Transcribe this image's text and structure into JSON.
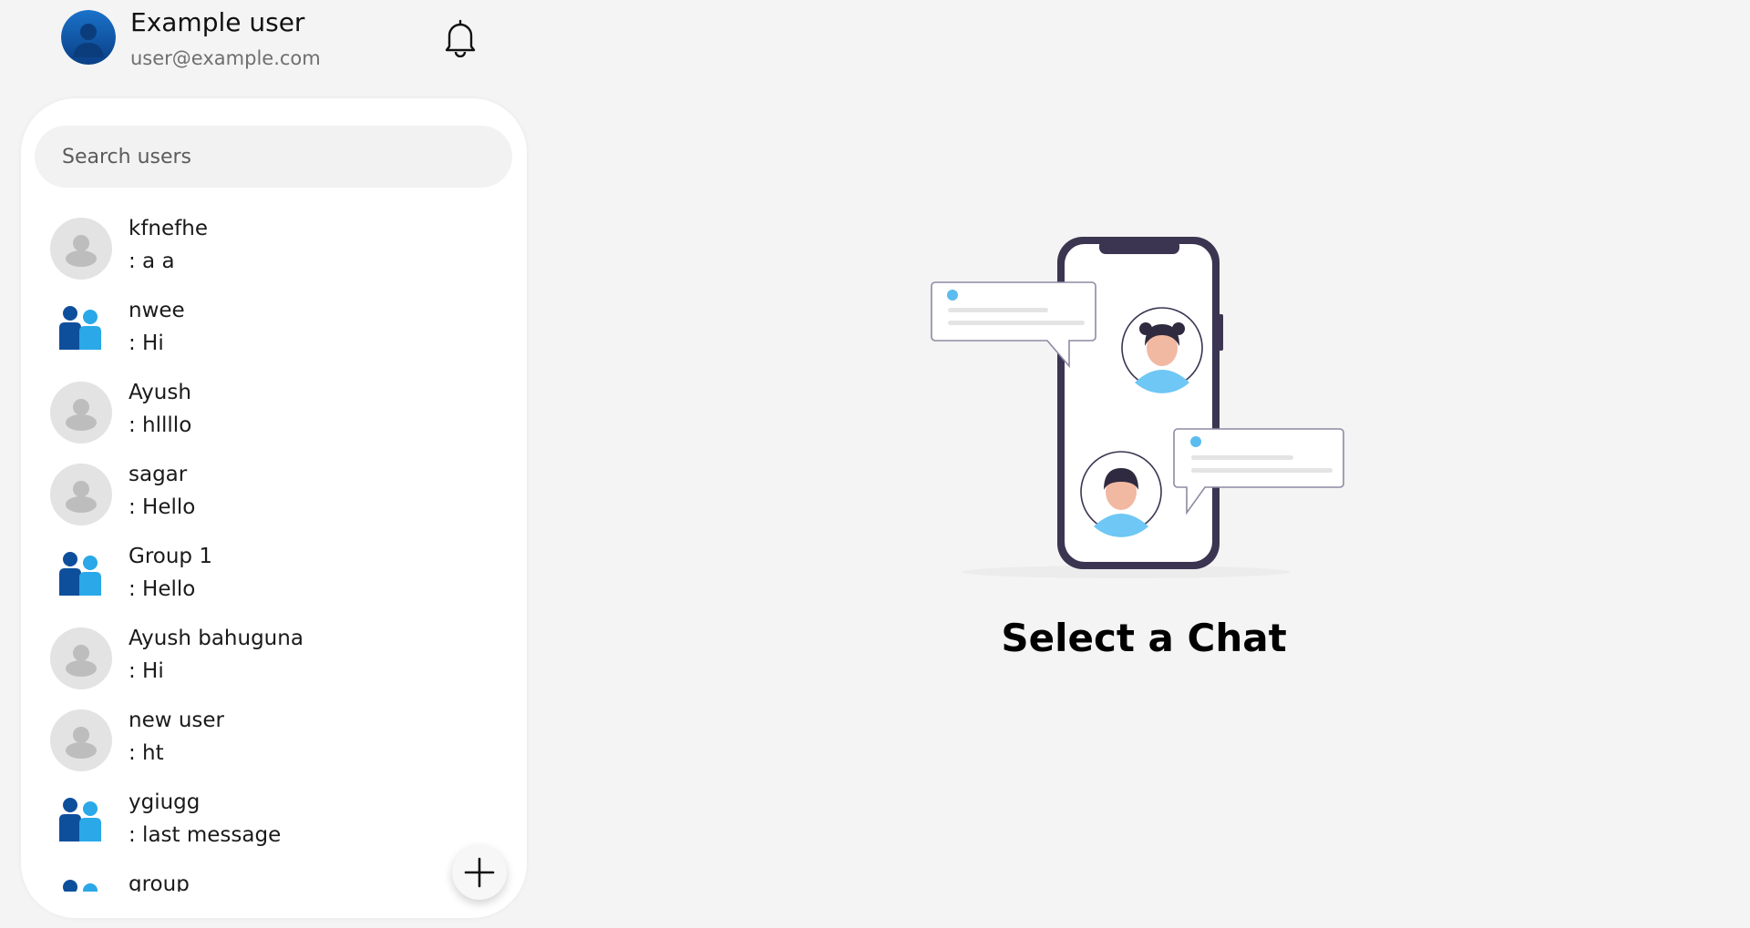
{
  "profile": {
    "name": "Example user",
    "email": "user@example.com",
    "avatar_icon": "user-avatar-icon",
    "notifications_icon": "bell-icon"
  },
  "search": {
    "placeholder": "Search users"
  },
  "chats": [
    {
      "name": "kfnefhe",
      "last_message": ": a a",
      "avatar": "default-user-icon"
    },
    {
      "name": "nwee",
      "last_message": ": Hi",
      "avatar": "group-icon"
    },
    {
      "name": "Ayush",
      "last_message": ": hllllo",
      "avatar": "default-user-icon"
    },
    {
      "name": "sagar",
      "last_message": ": Hello",
      "avatar": "default-user-icon"
    },
    {
      "name": "Group 1",
      "last_message": ": Hello",
      "avatar": "group-icon"
    },
    {
      "name": "Ayush bahuguna",
      "last_message": ": Hi",
      "avatar": "default-user-icon"
    },
    {
      "name": "new user",
      "last_message": ": ht",
      "avatar": "default-user-icon"
    },
    {
      "name": "ygiugg",
      "last_message": ": last message",
      "avatar": "group-icon"
    },
    {
      "name": "group",
      "last_message": "",
      "avatar": "group-icon"
    }
  ],
  "new_chat_button": {
    "icon": "plus-icon"
  },
  "main": {
    "empty_state_title": "Select a Chat",
    "illustration": "phone-chat-illustration"
  },
  "colors": {
    "background": "#f4f4f4",
    "card": "#ffffff",
    "brand_dark_blue": "#0e4f9c",
    "brand_light_blue": "#2aa8e8",
    "bubble_dot": "#5bbcf0",
    "phone_frame": "#3b3551"
  }
}
